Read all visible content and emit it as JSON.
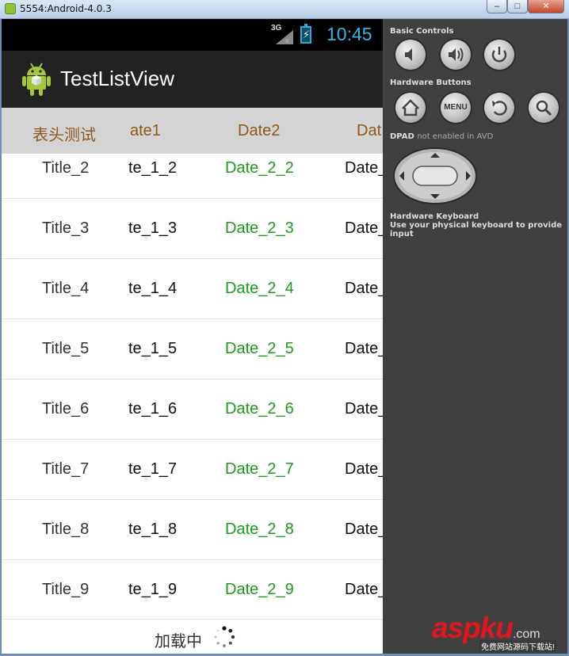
{
  "window": {
    "title": "5554:Android-4.0.3",
    "controls": {
      "minimize": "–",
      "maximize": "□",
      "close": "✕"
    }
  },
  "statusbar": {
    "network": "3G",
    "network_x": "x",
    "battery_glyph": "⚡",
    "time": "10:45",
    "time_color": "#33b5e5"
  },
  "actionbar": {
    "title": "TestListView",
    "icon": "android-robot-icon"
  },
  "list_header": {
    "columns": [
      "表头测试",
      "ate1",
      "Date2",
      "Dat"
    ]
  },
  "list": {
    "rows": [
      {
        "title": "Title_2",
        "date1": "te_1_2",
        "date2": "Date_2_2",
        "date3": "Date_"
      },
      {
        "title": "Title_3",
        "date1": "te_1_3",
        "date2": "Date_2_3",
        "date3": "Date_"
      },
      {
        "title": "Title_4",
        "date1": "te_1_4",
        "date2": "Date_2_4",
        "date3": "Date_"
      },
      {
        "title": "Title_5",
        "date1": "te_1_5",
        "date2": "Date_2_5",
        "date3": "Date_"
      },
      {
        "title": "Title_6",
        "date1": "te_1_6",
        "date2": "Date_2_6",
        "date3": "Date_"
      },
      {
        "title": "Title_7",
        "date1": "te_1_7",
        "date2": "Date_2_7",
        "date3": "Date_"
      },
      {
        "title": "Title_8",
        "date1": "te_1_8",
        "date2": "Date_2_8",
        "date3": "Date_"
      },
      {
        "title": "Title_9",
        "date1": "te_1_9",
        "date2": "Date_2_9",
        "date3": "Date_"
      }
    ],
    "date2_color": "#1d9a1d"
  },
  "loading": {
    "text": "加载中",
    "icon": "spinner-icon"
  },
  "emulator_panel": {
    "basic_controls_label": "Basic Controls",
    "hardware_buttons_label": "Hardware Buttons",
    "menu_label": "MENU",
    "dpad_label": "DPAD",
    "dpad_status": "not enabled in AVD",
    "keyboard_label": "Hardware Keyboard",
    "keyboard_hint": "Use your physical keyboard to provide input"
  },
  "watermark": {
    "brand": "aspku",
    "suffix": ".com",
    "sub": "免费网站源码下载站!"
  }
}
